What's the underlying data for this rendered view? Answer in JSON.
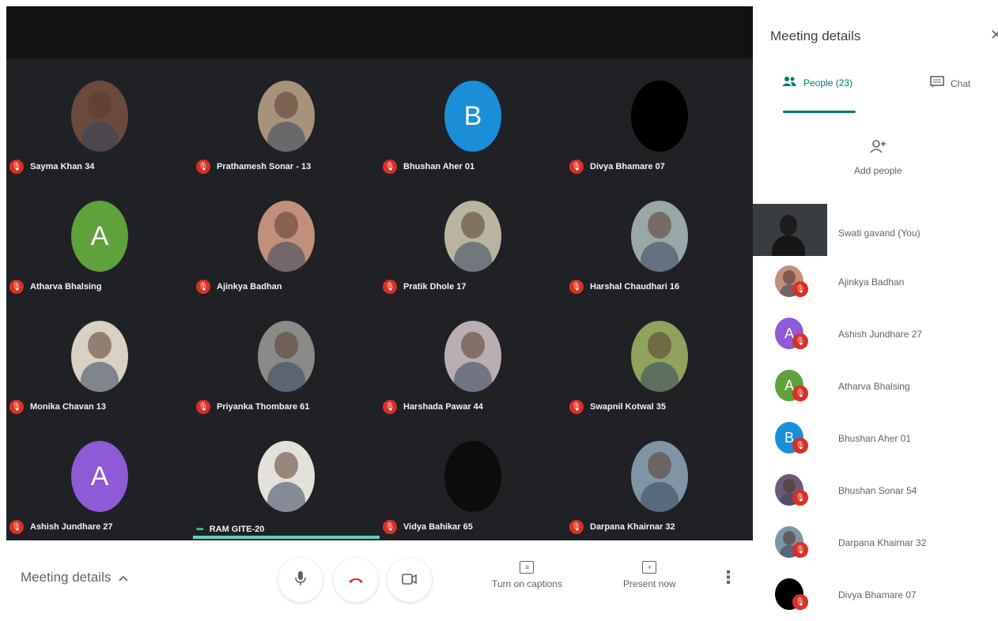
{
  "tiles": [
    {
      "name": "Sayma Khan 34",
      "avatar": "photo",
      "color": "#6b4a3a"
    },
    {
      "name": "Prathamesh Sonar - 13",
      "avatar": "photo",
      "color": "#a9927a"
    },
    {
      "name": "Bhushan Aher 01",
      "avatar": "letter",
      "letter": "B",
      "color": "#1a8fd8"
    },
    {
      "name": "Divya Bhamare 07",
      "avatar": "plain",
      "color": "#000000"
    },
    {
      "name": "Atharva Bhalsing",
      "avatar": "letter",
      "letter": "A",
      "color": "#5fa13a"
    },
    {
      "name": "Ajinkya Badhan",
      "avatar": "photo",
      "color": "#c28f7a"
    },
    {
      "name": "Pratik Dhole 17",
      "avatar": "photo",
      "color": "#b8b4a0"
    },
    {
      "name": "Harshal Chaudhari 16",
      "avatar": "photo",
      "color": "#9aa7a8"
    },
    {
      "name": "Monika Chavan 13",
      "avatar": "photo",
      "color": "#d9d1c4"
    },
    {
      "name": "Priyanka Thombare 61",
      "avatar": "photo",
      "color": "#8a8a86"
    },
    {
      "name": "Harshada Pawar 44",
      "avatar": "photo",
      "color": "#b9aeb2"
    },
    {
      "name": "Swapnil Kotwal 35",
      "avatar": "photo",
      "color": "#8fa35c"
    },
    {
      "name": "Ashish Jundhare 27",
      "avatar": "letter",
      "letter": "A",
      "color": "#8e5ad6"
    },
    {
      "name": "RAM GITE-20",
      "avatar": "photo",
      "color": "#e4e0da",
      "speaking": true
    },
    {
      "name": "Vidya Bahikar 65",
      "avatar": "plain",
      "color": "#0d0b0b"
    },
    {
      "name": "Darpana Khairnar 32",
      "avatar": "photo",
      "color": "#7f95a6"
    }
  ],
  "controls": {
    "meeting_details_label": "Meeting details",
    "mic_icon": "microphone-icon",
    "hangup_icon": "phone-hangup-icon",
    "camera_icon": "video-camera-icon",
    "captions_label": "Turn on captions",
    "present_label": "Present now"
  },
  "panel": {
    "title": "Meeting details",
    "people_tab": "People (23)",
    "chat_tab": "Chat",
    "add_people": "Add people",
    "you_name": "Swati gavand (You)",
    "people": [
      {
        "name": "Ajinkya Badhan",
        "avatar": "photo",
        "color": "#c28f7a"
      },
      {
        "name": "Ashish Jundhare 27",
        "avatar": "letter",
        "letter": "A",
        "color": "#8e5ad6"
      },
      {
        "name": "Atharva Bhalsing",
        "avatar": "letter",
        "letter": "A",
        "color": "#5fa13a"
      },
      {
        "name": "Bhushan Aher 01",
        "avatar": "letter",
        "letter": "B",
        "color": "#1a8fd8"
      },
      {
        "name": "Bhushan Sonar 54",
        "avatar": "photo",
        "color": "#6b5a78"
      },
      {
        "name": "Darpana Khairnar 32",
        "avatar": "photo",
        "color": "#7f95a6"
      },
      {
        "name": "Divya Bhamare 07",
        "avatar": "plain",
        "color": "#000000"
      }
    ]
  }
}
